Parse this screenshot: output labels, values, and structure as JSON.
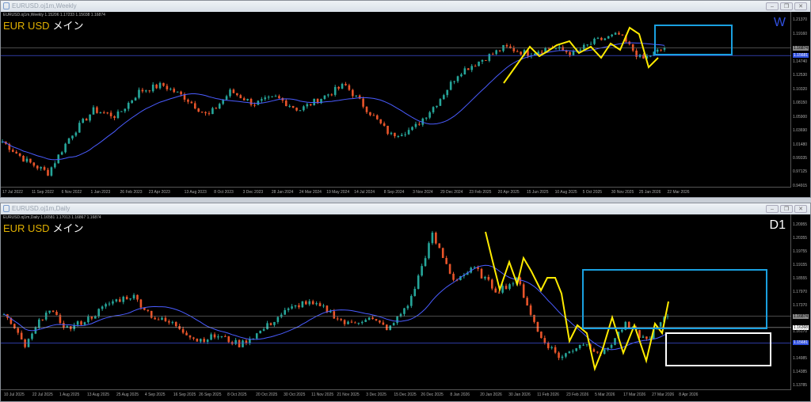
{
  "windows": [
    {
      "title": "EURUSD.oj1m,Weekly",
      "info": "EURUSD.oj1m,Weekly  1.15206 1.17233 1.15038 1.16874",
      "symbol": "EUR USD",
      "label": "メイン",
      "timeframe": "W",
      "price_labels": [
        "1.21370",
        "1.19160",
        "1.16874",
        "1.15681",
        "1.14740",
        "1.12530",
        "1.10320",
        "1.08150",
        "1.05900",
        "1.03690",
        "1.01480",
        "0.99335",
        "0.97125",
        "0.94915"
      ],
      "time_labels": [
        "17 Jul 2022",
        "11 Sep 2022",
        "6 Nov 2022",
        "1 Jan 2023",
        "26 Feb 2023",
        "23 Apr 2023",
        "13 Aug 2023",
        "8 Oct 2023",
        "3 Dec 2023",
        "28 Jan 2024",
        "24 Mar 2024",
        "19 May 2024",
        "14 Jul 2024",
        "8 Sep 2024",
        "3 Nov 2024",
        "29 Dec 2024",
        "23 Feb 2025",
        "20 Apr 2025",
        "15 Jun 2025",
        "10 Aug 2025",
        "5 Oct 2025",
        "30 Nov 2025",
        "25 Jan 2026",
        "22 Mar 2026"
      ]
    },
    {
      "title": "EURUSD.oj1m,Daily",
      "info": "EURUSD.oj1m,Daily  1.16581 1.17013 1.16867 1.16874",
      "symbol": "EUR USD",
      "label": "メイン",
      "timeframe": "D1",
      "price_labels": [
        "1.20955",
        "1.20355",
        "1.19755",
        "1.19155",
        "1.18555",
        "1.17970",
        "1.17370",
        "1.16874",
        "1.16368",
        "1.16170",
        "1.15681",
        "1.14985",
        "1.14385",
        "1.13785"
      ],
      "time_labels": [
        "10 Jul 2025",
        "22 Jul 2025",
        "1 Aug 2025",
        "13 Aug 2025",
        "25 Aug 2025",
        "4 Sep 2025",
        "16 Sep 2025",
        "26 Sep 2025",
        "8 Oct 2025",
        "20 Oct 2025",
        "30 Oct 2025",
        "11 Nov 2025",
        "21 Nov 2025",
        "3 Dec 2025",
        "15 Dec 2025",
        "26 Dec 2025",
        "8 Jan 2026",
        "20 Jan 2026",
        "30 Jan 2026",
        "11 Feb 2026",
        "23 Feb 2026",
        "5 Mar 2026",
        "17 Mar 2026",
        "27 Mar 2026",
        "8 Apr 2026"
      ]
    }
  ],
  "buttons": {
    "minimize": "–",
    "restore": "❐",
    "close": "✕"
  },
  "chart_data": [
    {
      "type": "candlestick",
      "timeframe": "W",
      "ylim": [
        0.94915,
        1.2137
      ],
      "bid": 1.16874,
      "ma_line": 1.15681,
      "close_keypoints": [
        1.02,
        0.99,
        0.97,
        1.03,
        1.07,
        1.06,
        1.1,
        1.11,
        1.09,
        1.06,
        1.1,
        1.08,
        1.09,
        1.07,
        1.09,
        1.11,
        1.07,
        1.03,
        1.04,
        1.08,
        1.13,
        1.15,
        1.17,
        1.16,
        1.17,
        1.16,
        1.18,
        1.19,
        1.15,
        1.169
      ]
    },
    {
      "type": "candlestick",
      "timeframe": "D1",
      "ylim": [
        1.13785,
        1.20955
      ],
      "bid": 1.16874,
      "line2": 1.16368,
      "ma_line": 1.15681,
      "close_keypoints": [
        1.17,
        1.155,
        1.172,
        1.163,
        1.168,
        1.175,
        1.178,
        1.168,
        1.165,
        1.158,
        1.16,
        1.156,
        1.162,
        1.17,
        1.175,
        1.172,
        1.165,
        1.168,
        1.163,
        1.176,
        1.205,
        1.185,
        1.19,
        1.18,
        1.185,
        1.16,
        1.15,
        1.157,
        1.152,
        1.165,
        1.158,
        1.169
      ]
    }
  ],
  "colors": {
    "bull": "#26a69a",
    "bear": "#e8542a",
    "ma": "#4a5cff",
    "zigzag": "#ffeb00",
    "box_blue": "#1aa0e0",
    "box_white": "#ffffff",
    "symbol": "#e0b000"
  }
}
